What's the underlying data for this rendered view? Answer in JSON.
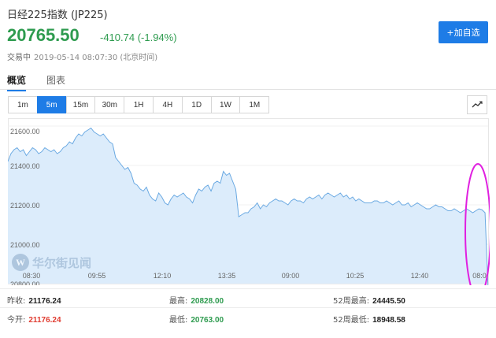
{
  "header": {
    "title": "日经225指数 (JP225)",
    "price": "20765.50",
    "change": "-410.74 (-1.94%)",
    "status": "交易中",
    "timestamp": "2019-05-14 08:07:30 (北京时间)",
    "watch_label": "+加自选"
  },
  "tabs": [
    {
      "label": "概览",
      "active": true
    },
    {
      "label": "图表",
      "active": false
    }
  ],
  "ranges": [
    {
      "label": "1m",
      "active": false
    },
    {
      "label": "5m",
      "active": true
    },
    {
      "label": "15m",
      "active": false
    },
    {
      "label": "30m",
      "active": false
    },
    {
      "label": "1H",
      "active": false
    },
    {
      "label": "4H",
      "active": false
    },
    {
      "label": "1D",
      "active": false
    },
    {
      "label": "1W",
      "active": false
    },
    {
      "label": "1M",
      "active": false
    }
  ],
  "watermark": "华尔街见闻",
  "colors": {
    "accent": "#1e7ce6",
    "down": "#2e9b4f",
    "up": "#e03c31",
    "area_fill": "#dcecfb",
    "area_line": "#6aa9e2",
    "annotation": "#e020e0"
  },
  "chart_data": {
    "type": "area",
    "ylim": [
      20800,
      21640
    ],
    "yticks": [
      "21600.00",
      "21400.00",
      "21200.00",
      "21000.00",
      "20800.00"
    ],
    "ytick_values": [
      21600,
      21400,
      21200,
      21000,
      20800
    ],
    "xticks": [
      "08:30",
      "09:55",
      "12:10",
      "13:35",
      "09:00",
      "10:25",
      "12:40",
      "08:0"
    ],
    "values": [
      21420,
      21460,
      21480,
      21490,
      21470,
      21480,
      21450,
      21470,
      21490,
      21480,
      21460,
      21470,
      21490,
      21480,
      21470,
      21480,
      21460,
      21470,
      21490,
      21500,
      21520,
      21510,
      21540,
      21560,
      21550,
      21570,
      21580,
      21590,
      21570,
      21560,
      21550,
      21560,
      21540,
      21520,
      21510,
      21440,
      21420,
      21400,
      21380,
      21390,
      21360,
      21310,
      21300,
      21280,
      21270,
      21290,
      21250,
      21230,
      21220,
      21260,
      21240,
      21210,
      21200,
      21230,
      21250,
      21240,
      21250,
      21260,
      21240,
      21230,
      21210,
      21250,
      21280,
      21270,
      21290,
      21300,
      21270,
      21310,
      21320,
      21310,
      21370,
      21350,
      21360,
      21320,
      21280,
      21140,
      21150,
      21160,
      21160,
      21180,
      21190,
      21210,
      21180,
      21200,
      21190,
      21210,
      21220,
      21230,
      21220,
      21220,
      21210,
      21200,
      21220,
      21230,
      21220,
      21220,
      21210,
      21230,
      21240,
      21230,
      21240,
      21250,
      21230,
      21250,
      21260,
      21250,
      21240,
      21250,
      21260,
      21240,
      21250,
      21230,
      21240,
      21220,
      21230,
      21220,
      21210,
      21210,
      21210,
      21220,
      21220,
      21210,
      21210,
      21220,
      21210,
      21200,
      21210,
      21220,
      21200,
      21200,
      21210,
      21190,
      21200,
      21210,
      21200,
      21190,
      21180,
      21180,
      21190,
      21200,
      21190,
      21190,
      21180,
      21170,
      21170,
      21180,
      21170,
      21160,
      21170,
      21180,
      21170,
      21160,
      21170,
      21180,
      21175,
      21160,
      20765
    ],
    "annotation": "circle"
  },
  "stats": [
    {
      "label": "昨收",
      "value": "21176.24",
      "tone": "dark"
    },
    {
      "label": "最高",
      "value": "20828.00",
      "tone": "green"
    },
    {
      "label": "52周最高",
      "value": "24445.50",
      "tone": "dark"
    },
    {
      "label": "今开",
      "value": "21176.24",
      "tone": "red"
    },
    {
      "label": "最低",
      "value": "20763.00",
      "tone": "green"
    },
    {
      "label": "52周最低",
      "value": "18948.58",
      "tone": "dark"
    }
  ]
}
